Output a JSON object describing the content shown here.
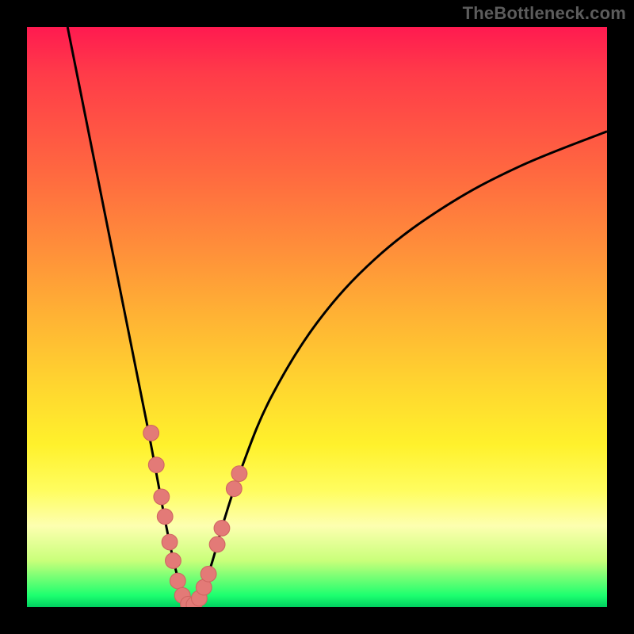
{
  "watermark": "TheBottleneck.com",
  "colors": {
    "background": "#000000",
    "curve": "#000000",
    "dot_fill": "#e37a77",
    "dot_stroke": "#d06562",
    "gradient_top": "#ff1a50",
    "gradient_bottom": "#00d060"
  },
  "chart_data": {
    "type": "line",
    "title": "",
    "xlabel": "",
    "ylabel": "",
    "xlim": [
      0,
      100
    ],
    "ylim": [
      0,
      100
    ],
    "left_branch": {
      "name": "left",
      "points": [
        [
          7,
          100
        ],
        [
          9,
          90
        ],
        [
          11,
          80
        ],
        [
          13,
          70
        ],
        [
          15,
          60
        ],
        [
          17,
          50
        ],
        [
          19,
          40
        ],
        [
          21,
          30
        ],
        [
          22.5,
          22
        ],
        [
          24,
          14
        ],
        [
          25.5,
          7
        ],
        [
          27,
          2
        ],
        [
          28.5,
          0
        ]
      ]
    },
    "right_branch": {
      "name": "right",
      "points": [
        [
          28.5,
          0
        ],
        [
          30,
          2
        ],
        [
          32,
          8
        ],
        [
          34,
          15
        ],
        [
          37,
          24
        ],
        [
          42,
          36
        ],
        [
          50,
          49
        ],
        [
          60,
          60
        ],
        [
          72,
          69
        ],
        [
          85,
          76
        ],
        [
          100,
          82
        ]
      ]
    },
    "markers": [
      [
        21.4,
        30.0
      ],
      [
        22.3,
        24.5
      ],
      [
        23.2,
        19.0
      ],
      [
        23.8,
        15.6
      ],
      [
        24.6,
        11.2
      ],
      [
        25.2,
        8.0
      ],
      [
        26.0,
        4.5
      ],
      [
        26.8,
        2.0
      ],
      [
        27.8,
        0.5
      ],
      [
        28.8,
        0.4
      ],
      [
        29.7,
        1.5
      ],
      [
        30.5,
        3.4
      ],
      [
        31.3,
        5.7
      ],
      [
        32.8,
        10.8
      ],
      [
        33.6,
        13.6
      ],
      [
        35.7,
        20.4
      ],
      [
        36.6,
        23.0
      ]
    ]
  }
}
